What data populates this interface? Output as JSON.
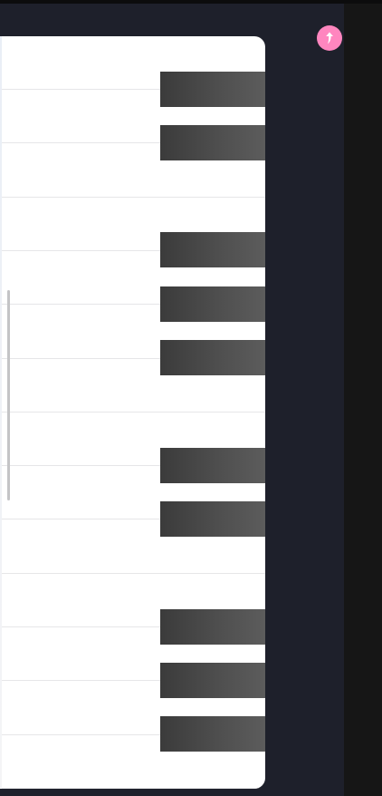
{
  "window": {
    "colors": {
      "panel": "#1e202b",
      "right_strip": "#161616",
      "keyboard": "#ffffff",
      "black_key": "#4a4a4a",
      "accent": "#ff86bf"
    }
  },
  "piano": {
    "white_key_count": 14,
    "black_key_rows": [
      0,
      1,
      3,
      4,
      5,
      7,
      8,
      10,
      11,
      12
    ]
  },
  "action_button": {
    "icon": "sharp-arrow-up-icon"
  }
}
